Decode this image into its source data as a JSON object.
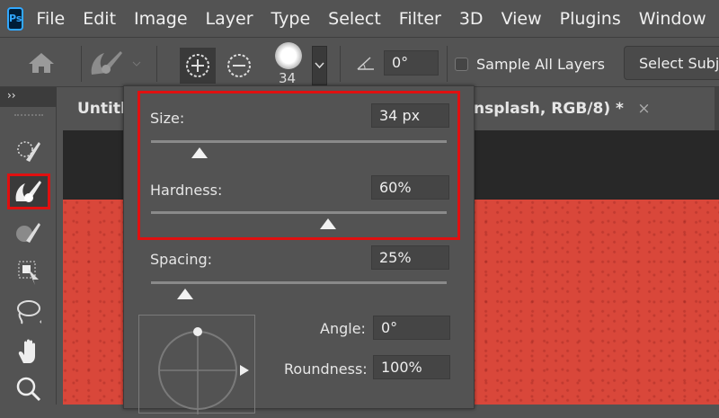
{
  "menubar": {
    "logo": "Ps",
    "items": [
      "File",
      "Edit",
      "Image",
      "Layer",
      "Type",
      "Select",
      "Filter",
      "3D",
      "View",
      "Plugins",
      "Window"
    ]
  },
  "options": {
    "brush_size_preview": "34",
    "angle_value": "0°",
    "sample_all_layers_label": "Sample All Layers",
    "sample_all_layers_checked": false,
    "select_subject_label": "Select Subj"
  },
  "toolbar": {
    "expand": "››",
    "selected_tool": "quick-selection"
  },
  "tabs": {
    "left_tab": "Untitl",
    "right_tab": "nsplash, RGB/8) *",
    "close": "×"
  },
  "brush_panel": {
    "size": {
      "label": "Size:",
      "value": "34 px",
      "slider": 0.165
    },
    "hardness": {
      "label": "Hardness:",
      "value": "60%",
      "slider": 0.6
    },
    "spacing": {
      "label": "Spacing:",
      "value": "25%",
      "slider": 0.115
    },
    "angle": {
      "label": "Angle:",
      "value": "0°"
    },
    "roundness": {
      "label": "Roundness:",
      "value": "100%"
    }
  },
  "colors": {
    "highlight": "#e01010",
    "canvas": "#d9473a"
  }
}
